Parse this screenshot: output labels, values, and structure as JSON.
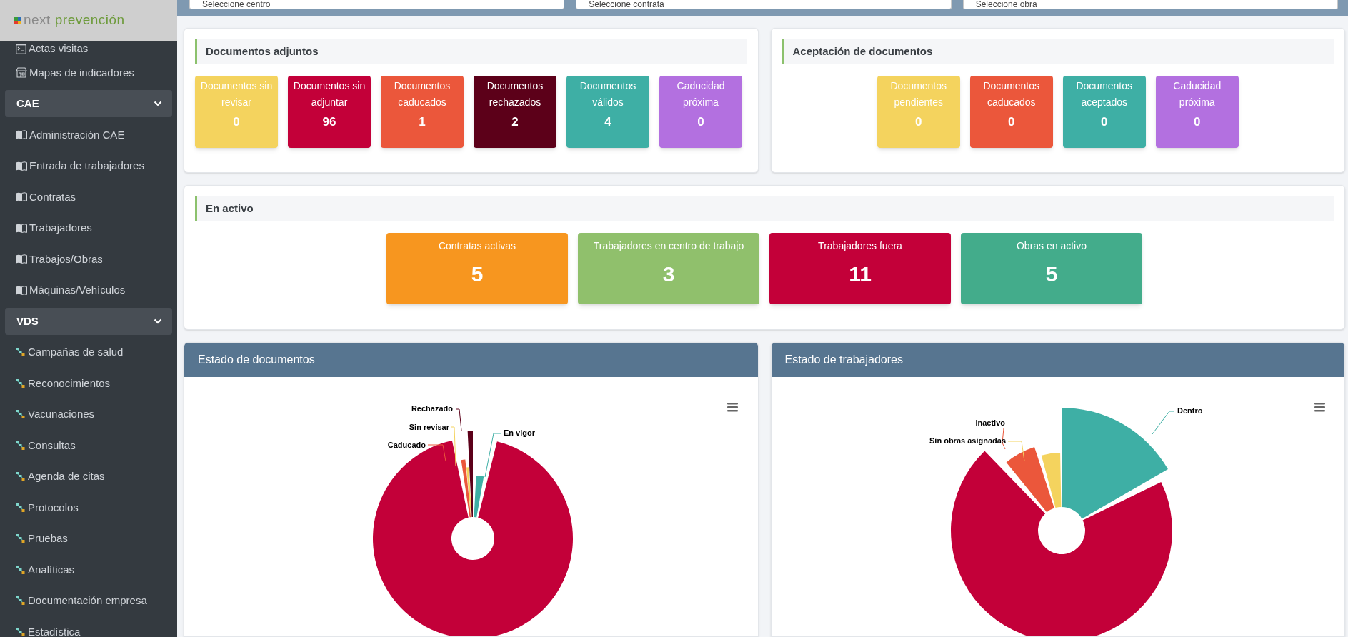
{
  "logo": {
    "word_1": "next",
    "word_2": "prevención"
  },
  "sidebar": {
    "items": [
      {
        "kind": "link",
        "label": "Actas visitas"
      },
      {
        "kind": "link",
        "label": "Mapas de indicadores"
      },
      {
        "kind": "group",
        "label": "CAE",
        "expanded": true,
        "children": [
          {
            "label": "Administración CAE"
          },
          {
            "label": "Entrada de trabajadores"
          },
          {
            "label": "Contratas"
          },
          {
            "label": "Trabajadores"
          },
          {
            "label": "Trabajos/Obras"
          },
          {
            "label": "Máquinas/Vehículos"
          }
        ]
      },
      {
        "kind": "group",
        "label": "VDS",
        "expanded": true,
        "children": [
          {
            "label": "Campañas de salud"
          },
          {
            "label": "Reconocimientos"
          },
          {
            "label": "Vacunaciones"
          },
          {
            "label": "Consultas"
          },
          {
            "label": "Agenda de citas"
          },
          {
            "label": "Protocolos"
          },
          {
            "label": "Pruebas"
          },
          {
            "label": "Analíticas"
          },
          {
            "label": "Documentación empresa"
          },
          {
            "label": "Estadística"
          }
        ]
      }
    ]
  },
  "filters": [
    {
      "placeholder": "Seleccione centro"
    },
    {
      "placeholder": "Seleccione contrata"
    },
    {
      "placeholder": "Seleccione obra"
    }
  ],
  "panels": [
    {
      "title": "Documentos adjuntos",
      "tiles": [
        {
          "label": "Documentos sin revisar",
          "value": "0",
          "color": "#f4d35e"
        },
        {
          "label": "Documentos sin adjuntar",
          "value": "96",
          "color": "#c30039"
        },
        {
          "label": "Documentos caducados",
          "value": "1",
          "color": "#eb573b"
        },
        {
          "label": "Documentos rechazados",
          "value": "2",
          "color": "#5c0019"
        },
        {
          "label": "Documentos válidos",
          "value": "4",
          "color": "#3eafa5"
        },
        {
          "label": "Caducidad próxima",
          "value": "0",
          "color": "#b370e0"
        }
      ]
    },
    {
      "title": "Aceptación de documentos",
      "tiles": [
        {
          "label": "Documentos pendientes",
          "value": "0",
          "color": "#f4d35e"
        },
        {
          "label": "Documentos caducados",
          "value": "0",
          "color": "#eb573b"
        },
        {
          "label": "Documentos aceptados",
          "value": "0",
          "color": "#3eafa5"
        },
        {
          "label": "Caducidad próxima",
          "value": "0",
          "color": "#b370e0"
        }
      ]
    }
  ],
  "active": {
    "title": "En activo",
    "tiles": [
      {
        "label": "Contratas activas",
        "value": "5",
        "color": "#f7961f"
      },
      {
        "label": "Trabajadores en centro de trabajo",
        "value": "3",
        "color": "#90c06c"
      },
      {
        "label": "Trabajadores fuera",
        "value": "11",
        "color": "#c30039"
      },
      {
        "label": "Obras en activo",
        "value": "5",
        "color": "#43ac8b"
      }
    ]
  },
  "charts": [
    {
      "title": "Estado de documentos",
      "slices": [
        {
          "label": "En vigor",
          "color": "#3eafa5"
        },
        {
          "color": "#c30039"
        },
        {
          "label": "Caducado",
          "color": "#eb573b"
        },
        {
          "label": "Sin revisar",
          "color": "#f4d35e"
        },
        {
          "label": "Rechazado",
          "color": "#5c0019"
        }
      ]
    },
    {
      "title": "Estado de trabajadores",
      "slices": [
        {
          "label": "Dentro",
          "color": "#3eafa5"
        },
        {
          "color": "#c30039"
        },
        {
          "label": "Inactivo",
          "color": "#eb573b"
        },
        {
          "label": "Sin obras asignadas",
          "color": "#f4d35e"
        }
      ]
    }
  ]
}
